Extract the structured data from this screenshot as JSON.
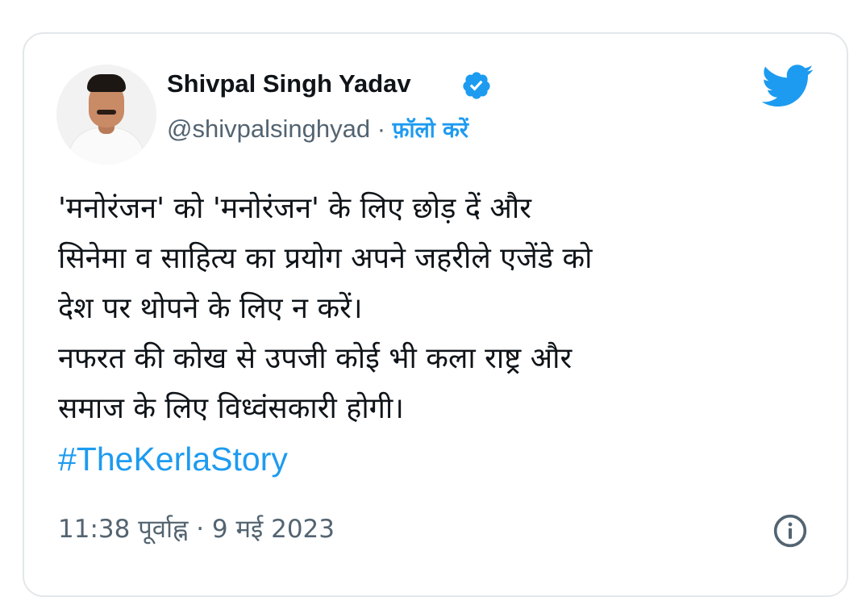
{
  "tweet": {
    "author": {
      "display_name": "Shivpal Singh Yadav",
      "handle": "@shivpalsinghyad",
      "separator": "·",
      "follow_label": "फ़ॉलो करें",
      "verified": true
    },
    "text_lines": [
      "'मनोरंजन' को 'मनोरंजन' के लिए छोड़ दें और",
      "सिनेमा व साहित्य का प्रयोग अपने जहरीले एजेंडे को",
      "देश पर थोपने के लिए न करें।",
      "नफरत की कोख से उपजी कोई भी कला राष्ट्र और",
      "समाज के लिए विध्वंसकारी होगी।"
    ],
    "hashtag": "#TheKerlaStory",
    "timestamp": "11:38 पूर्वाह्न · 9 मई 2023"
  },
  "icons": {
    "platform_logo": "twitter-bird-icon",
    "verified_badge": "verified-badge-icon",
    "info": "info-icon"
  },
  "colors": {
    "accent": "#1d9bf0",
    "text_primary": "#0f1419",
    "text_secondary": "#536471",
    "card_border": "#e3e7ea"
  }
}
